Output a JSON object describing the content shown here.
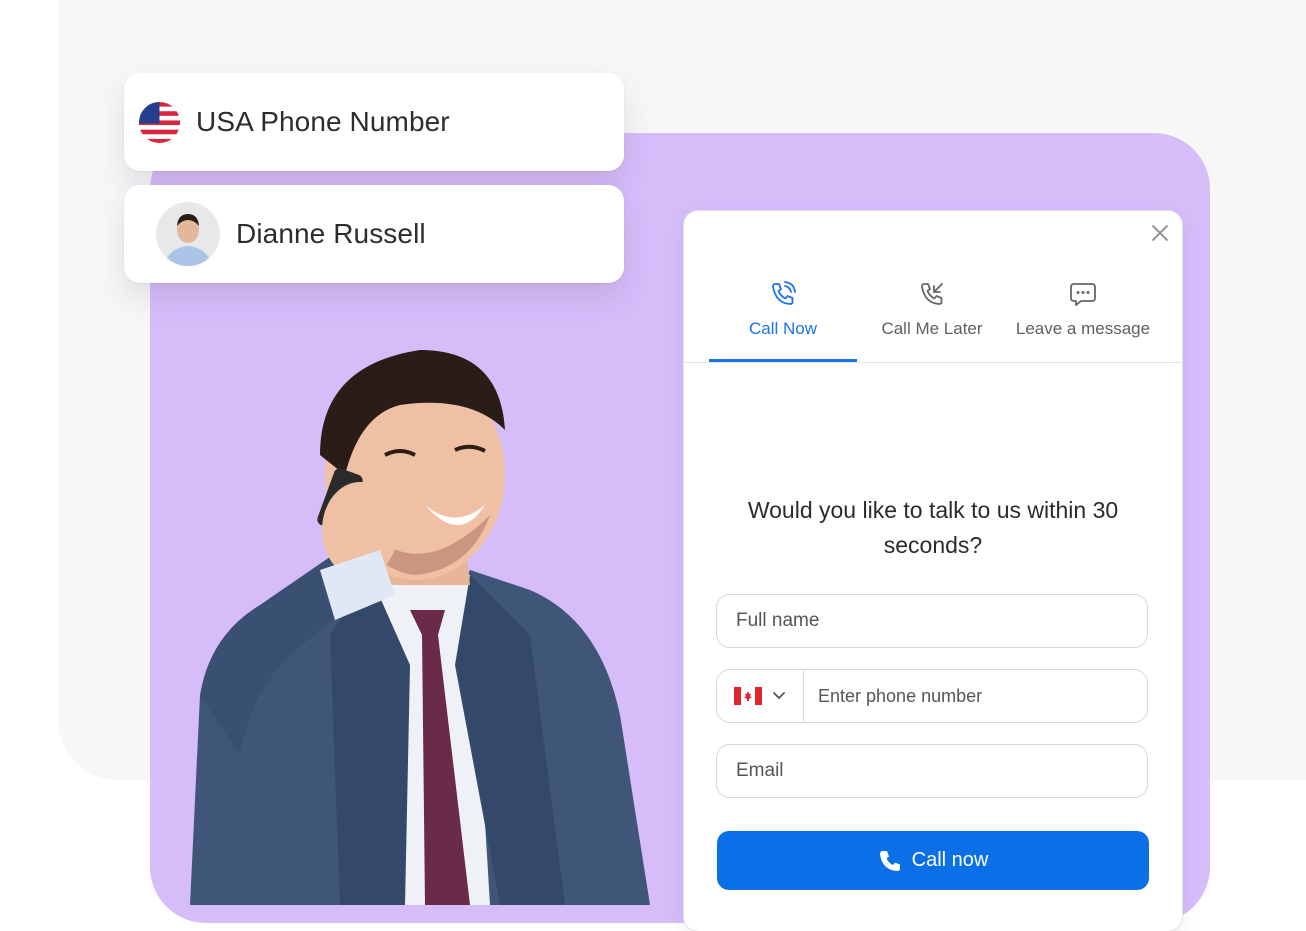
{
  "cards": {
    "phone_number_label": "USA Phone Number",
    "contact_name": "Dianne Russell"
  },
  "widget": {
    "tabs": [
      {
        "label": "Call Now",
        "active": true
      },
      {
        "label": "Call Me Later",
        "active": false
      },
      {
        "label": "Leave a message",
        "active": false
      }
    ],
    "question": "Would you like to talk to us within 30 seconds?",
    "full_name_placeholder": "Full name",
    "phone_placeholder": "Enter phone number",
    "email_placeholder": "Email",
    "selected_country": "Canada",
    "call_button_label": "Call now"
  },
  "colors": {
    "accent": "#1a73e8",
    "button": "#0b6fe8",
    "purple_backdrop": "#d6bdfa"
  }
}
